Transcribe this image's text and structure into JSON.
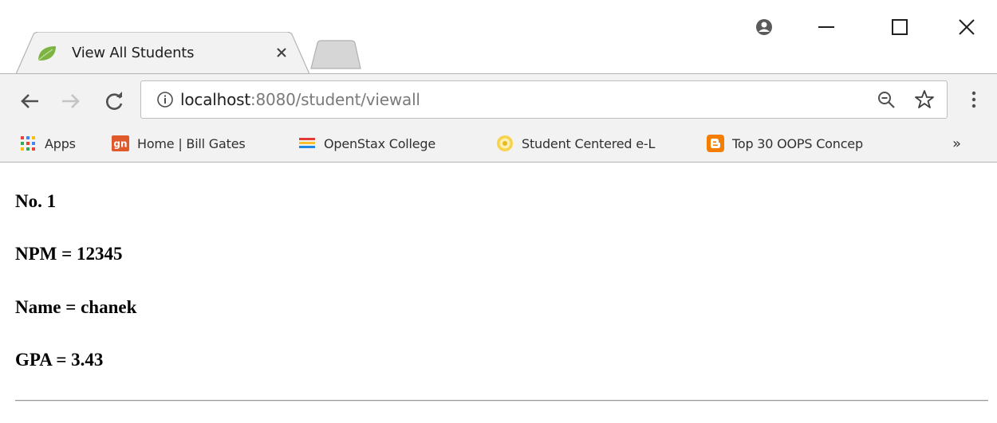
{
  "browser": {
    "tab": {
      "title": "View All Students",
      "favicon": "spring-leaf-icon"
    },
    "window_controls": [
      "profile-icon",
      "minimize-icon",
      "maximize-icon",
      "close-icon"
    ],
    "address_bar": {
      "host": "localhost",
      "path": ":8080/student/viewall"
    },
    "bookmarks": [
      {
        "label": "Apps",
        "icon": "apps-grid-icon"
      },
      {
        "label": "Home | Bill Gates",
        "icon": "gn-icon"
      },
      {
        "label": "OpenStax College",
        "icon": "books-icon"
      },
      {
        "label": "Student Centered e-L",
        "icon": "university-seal-icon"
      },
      {
        "label": "Top 30 OOPS Concep",
        "icon": "blogger-icon"
      }
    ],
    "bookmarks_overflow": "»"
  },
  "page": {
    "student": {
      "number_line": "No. 1",
      "npm_line": "NPM = 12345",
      "name_line": "Name = chanek",
      "gpa_line": "GPA = 3.43"
    }
  },
  "colors": {
    "chrome_bg": "#f2f2f2",
    "border": "#b4b4b4",
    "leaf_green": "#7cb342",
    "blogger_orange": "#f57d00",
    "gn_orange": "#e0592a"
  }
}
